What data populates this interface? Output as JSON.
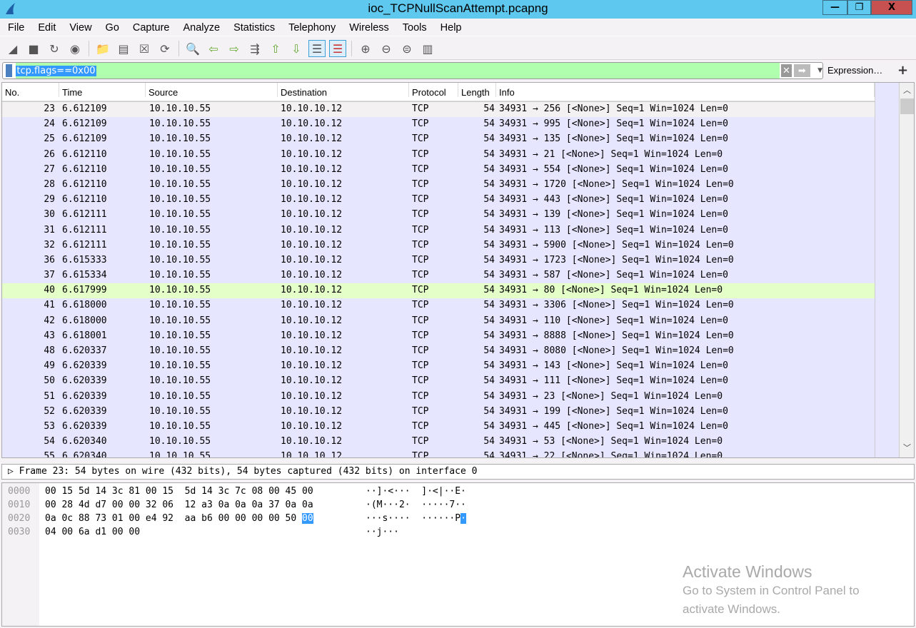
{
  "window": {
    "title": "ioc_TCPNullScanAttempt.pcapng",
    "minimize": "—",
    "restore": "❐",
    "close": "X"
  },
  "menu": [
    "File",
    "Edit",
    "View",
    "Go",
    "Capture",
    "Analyze",
    "Statistics",
    "Telephony",
    "Wireless",
    "Tools",
    "Help"
  ],
  "toolbar": [
    "shark-start-icon",
    "stop-icon",
    "restart-icon",
    "options-icon",
    "open-folder-icon",
    "save-file-icon",
    "close-file-icon",
    "reload-icon",
    "find-icon",
    "back-icon",
    "forward-icon",
    "go-to-packet-icon",
    "first-packet-icon",
    "last-packet-icon",
    "autoscroll-icon",
    "colorize-icon",
    "zoom-in-icon",
    "zoom-out-icon",
    "normal-size-icon",
    "resize-columns-icon"
  ],
  "filter": {
    "value": "tcp.flags==0x00",
    "expression_label": "Expression…",
    "add_label": "+"
  },
  "columns": [
    "No.",
    "Time",
    "Source",
    "Destination",
    "Protocol",
    "Length",
    "Info"
  ],
  "packets": [
    [
      "23",
      "6.612109",
      "10.10.10.55",
      "10.10.10.12",
      "TCP",
      "54",
      "34931 → 256 [<None>] Seq=1 Win=1024 Len=0"
    ],
    [
      "24",
      "6.612109",
      "10.10.10.55",
      "10.10.10.12",
      "TCP",
      "54",
      "34931 → 995 [<None>] Seq=1 Win=1024 Len=0"
    ],
    [
      "25",
      "6.612109",
      "10.10.10.55",
      "10.10.10.12",
      "TCP",
      "54",
      "34931 → 135 [<None>] Seq=1 Win=1024 Len=0"
    ],
    [
      "26",
      "6.612110",
      "10.10.10.55",
      "10.10.10.12",
      "TCP",
      "54",
      "34931 → 21 [<None>] Seq=1 Win=1024 Len=0"
    ],
    [
      "27",
      "6.612110",
      "10.10.10.55",
      "10.10.10.12",
      "TCP",
      "54",
      "34931 → 554 [<None>] Seq=1 Win=1024 Len=0"
    ],
    [
      "28",
      "6.612110",
      "10.10.10.55",
      "10.10.10.12",
      "TCP",
      "54",
      "34931 → 1720 [<None>] Seq=1 Win=1024 Len=0"
    ],
    [
      "29",
      "6.612110",
      "10.10.10.55",
      "10.10.10.12",
      "TCP",
      "54",
      "34931 → 443 [<None>] Seq=1 Win=1024 Len=0"
    ],
    [
      "30",
      "6.612111",
      "10.10.10.55",
      "10.10.10.12",
      "TCP",
      "54",
      "34931 → 139 [<None>] Seq=1 Win=1024 Len=0"
    ],
    [
      "31",
      "6.612111",
      "10.10.10.55",
      "10.10.10.12",
      "TCP",
      "54",
      "34931 → 113 [<None>] Seq=1 Win=1024 Len=0"
    ],
    [
      "32",
      "6.612111",
      "10.10.10.55",
      "10.10.10.12",
      "TCP",
      "54",
      "34931 → 5900 [<None>] Seq=1 Win=1024 Len=0"
    ],
    [
      "36",
      "6.615333",
      "10.10.10.55",
      "10.10.10.12",
      "TCP",
      "54",
      "34931 → 1723 [<None>] Seq=1 Win=1024 Len=0"
    ],
    [
      "37",
      "6.615334",
      "10.10.10.55",
      "10.10.10.12",
      "TCP",
      "54",
      "34931 → 587 [<None>] Seq=1 Win=1024 Len=0"
    ],
    [
      "40",
      "6.617999",
      "10.10.10.55",
      "10.10.10.12",
      "TCP",
      "54",
      "34931 → 80 [<None>] Seq=1 Win=1024 Len=0"
    ],
    [
      "41",
      "6.618000",
      "10.10.10.55",
      "10.10.10.12",
      "TCP",
      "54",
      "34931 → 3306 [<None>] Seq=1 Win=1024 Len=0"
    ],
    [
      "42",
      "6.618000",
      "10.10.10.55",
      "10.10.10.12",
      "TCP",
      "54",
      "34931 → 110 [<None>] Seq=1 Win=1024 Len=0"
    ],
    [
      "43",
      "6.618001",
      "10.10.10.55",
      "10.10.10.12",
      "TCP",
      "54",
      "34931 → 8888 [<None>] Seq=1 Win=1024 Len=0"
    ],
    [
      "48",
      "6.620337",
      "10.10.10.55",
      "10.10.10.12",
      "TCP",
      "54",
      "34931 → 8080 [<None>] Seq=1 Win=1024 Len=0"
    ],
    [
      "49",
      "6.620339",
      "10.10.10.55",
      "10.10.10.12",
      "TCP",
      "54",
      "34931 → 143 [<None>] Seq=1 Win=1024 Len=0"
    ],
    [
      "50",
      "6.620339",
      "10.10.10.55",
      "10.10.10.12",
      "TCP",
      "54",
      "34931 → 111 [<None>] Seq=1 Win=1024 Len=0"
    ],
    [
      "51",
      "6.620339",
      "10.10.10.55",
      "10.10.10.12",
      "TCP",
      "54",
      "34931 → 23 [<None>] Seq=1 Win=1024 Len=0"
    ],
    [
      "52",
      "6.620339",
      "10.10.10.55",
      "10.10.10.12",
      "TCP",
      "54",
      "34931 → 199 [<None>] Seq=1 Win=1024 Len=0"
    ],
    [
      "53",
      "6.620339",
      "10.10.10.55",
      "10.10.10.12",
      "TCP",
      "54",
      "34931 → 445 [<None>] Seq=1 Win=1024 Len=0"
    ],
    [
      "54",
      "6.620340",
      "10.10.10.55",
      "10.10.10.12",
      "TCP",
      "54",
      "34931 → 53 [<None>] Seq=1 Win=1024 Len=0"
    ],
    [
      "55",
      "6.620340",
      "10.10.10.55",
      "10.10.10.12",
      "TCP",
      "54",
      "34931 → 22 [<None>] Seq=1 Win=1024 Len=0"
    ]
  ],
  "selected_packet": "23",
  "highlight_packet": "40",
  "colors": {
    "row": "#e7e6ff",
    "highlight": "#e4ffc7",
    "filter_ok": "#afffaf",
    "titlebar": "#5ec8ee"
  },
  "detail": "Frame 23: 54 bytes on wire (432 bits), 54 bytes captured (432 bits) on interface 0",
  "bytes": [
    {
      "off": "0000",
      "hex": "00 15 5d 14 3c 81 00 15  5d 14 3c 7c 08 00 45 00",
      "asc": "··]·<···  ]·<|··E·"
    },
    {
      "off": "0010",
      "hex": "00 28 4d d7 00 00 32 06  12 a3 0a 0a 0a 37 0a 0a",
      "asc": "·(M···2·  ·····7··"
    },
    {
      "off": "0020",
      "hex": "0a 0c 88 73 01 00 e4 92  aa b6 00 00 00 00 50 ",
      "hexhl": "00",
      "asc": "···s····  ······P",
      "aschl": "·"
    },
    {
      "off": "0030",
      "hex": "04 00 6a d1 00 00",
      "asc": "··j···"
    }
  ],
  "watermark": {
    "title": "Activate Windows",
    "subtitle": "Go to System in Control Panel to activate Windows."
  }
}
